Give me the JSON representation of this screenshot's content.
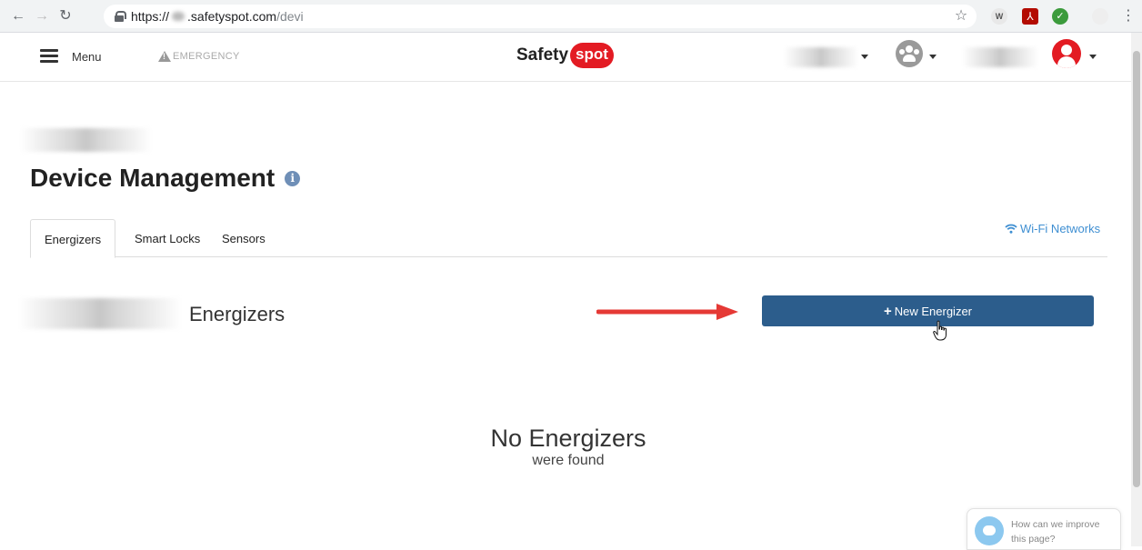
{
  "browser": {
    "url_scheme": "https://",
    "url_host": ".safetyspot.com",
    "url_path": "/devi"
  },
  "header": {
    "menu_label": "Menu",
    "emergency_label": "EMERGENCY",
    "logo_text": "Safety",
    "logo_badge": "spot",
    "accent_color": "#e31b23"
  },
  "page": {
    "title": "Device Management",
    "tabs": [
      {
        "label": "Energizers",
        "active": true
      },
      {
        "label": "Smart Locks",
        "active": false
      },
      {
        "label": "Sensors",
        "active": false
      }
    ],
    "wifi_link": "Wi-Fi Networks",
    "section_title": "Energizers",
    "new_button": "New Energizer",
    "empty_title": "No Energizers",
    "empty_subtitle": "were found",
    "button_color": "#2c5d8c"
  },
  "feedback": {
    "text": "How can we improve this page?"
  }
}
